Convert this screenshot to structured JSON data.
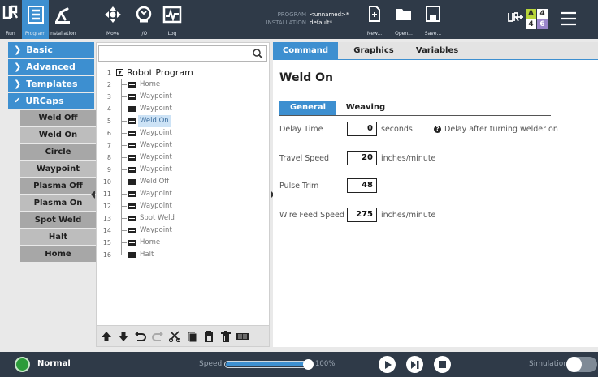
{
  "header": {
    "buttons": [
      {
        "id": "run",
        "label": "Run",
        "icon": "ur-logo-icon"
      },
      {
        "id": "program",
        "label": "Program",
        "icon": "program-tree-icon",
        "active": true
      },
      {
        "id": "installation",
        "label": "Installation",
        "icon": "installation-robot-icon"
      },
      {
        "id": "move",
        "label": "Move",
        "icon": "move-arrows-icon"
      },
      {
        "id": "io",
        "label": "I/O",
        "icon": "io-icon"
      },
      {
        "id": "log",
        "label": "Log",
        "icon": "log-icon"
      }
    ],
    "program_label": "PROGRAM",
    "program_name": "<unnamed>*",
    "installation_label": "INSTALLATION",
    "installation_name": "default*",
    "file_buttons": [
      {
        "id": "new",
        "label": "New..."
      },
      {
        "id": "open",
        "label": "Open..."
      },
      {
        "id": "save",
        "label": "Save..."
      }
    ],
    "io_indicator": {
      "a_label": "A",
      "a_value": "4",
      "b_value": "4",
      "c_value": "6"
    }
  },
  "left_nav": {
    "sections": [
      "Basic",
      "Advanced",
      "Templates",
      "URCaps"
    ],
    "urcaps_items": [
      "Weld Off",
      "Weld On",
      "Circle",
      "Waypoint",
      "Plasma Off",
      "Plasma On",
      "Spot Weld",
      "Halt",
      "Home"
    ]
  },
  "tree": {
    "search_placeholder": "",
    "root": {
      "num": "1",
      "label": "Robot Program"
    },
    "rows": [
      {
        "num": "2",
        "label": "Home"
      },
      {
        "num": "3",
        "label": "Waypoint"
      },
      {
        "num": "4",
        "label": "Waypoint"
      },
      {
        "num": "5",
        "label": "Weld On",
        "selected": true
      },
      {
        "num": "6",
        "label": "Waypoint"
      },
      {
        "num": "7",
        "label": "Waypoint"
      },
      {
        "num": "8",
        "label": "Waypoint"
      },
      {
        "num": "9",
        "label": "Waypoint"
      },
      {
        "num": "10",
        "label": "Weld Off"
      },
      {
        "num": "11",
        "label": "Waypoint"
      },
      {
        "num": "12",
        "label": "Waypoint"
      },
      {
        "num": "13",
        "label": "Spot Weld"
      },
      {
        "num": "14",
        "label": "Waypoint"
      },
      {
        "num": "15",
        "label": "Home"
      },
      {
        "num": "16",
        "label": "Halt"
      }
    ],
    "toolbar_icons": [
      "move-up-icon",
      "move-down-icon",
      "undo-icon",
      "redo-icon",
      "cut-icon",
      "copy-icon",
      "paste-icon",
      "delete-icon",
      "suppress-icon"
    ]
  },
  "right": {
    "tabs": [
      "Command",
      "Graphics",
      "Variables"
    ],
    "title": "Weld On",
    "subtabs": [
      "General",
      "Weaving"
    ],
    "fields": [
      {
        "label": "Delay Time",
        "value": "0",
        "unit": "seconds",
        "hint": "Delay after turning welder on"
      },
      {
        "label": "Travel Speed",
        "value": "20",
        "unit": "inches/minute"
      },
      {
        "label": "Pulse Trim",
        "value": "48",
        "unit": ""
      },
      {
        "label": "Wire Feed Speed",
        "value": "275",
        "unit": "inches/minute"
      }
    ]
  },
  "footer": {
    "status": "Normal",
    "speed_label": "Speed",
    "speed_value": "100%",
    "speed_fraction": 1.0,
    "simulation_label": "Simulation"
  },
  "colors": {
    "header_bg": "#2f3a48",
    "accent": "#3d8fd0",
    "status_green": "#2c9b3a"
  }
}
